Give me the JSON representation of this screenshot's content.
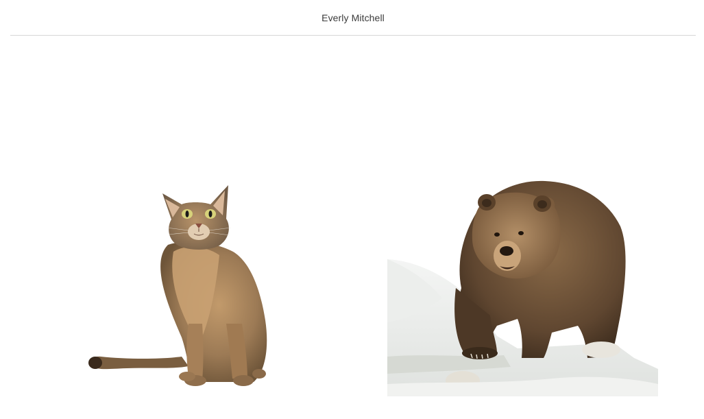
{
  "header": {
    "title": "Everly Mitchell"
  },
  "gallery": {
    "items": [
      {
        "id": "cat",
        "icon": "cat-photo",
        "animal": "cat"
      },
      {
        "id": "bear",
        "icon": "bear-photo",
        "animal": "bear"
      }
    ]
  },
  "colors": {
    "divider": "#d6d6d6",
    "cat_fur": "#9a7a55",
    "bear_fur": "#6b4e33",
    "snow": "#e9ecea"
  }
}
